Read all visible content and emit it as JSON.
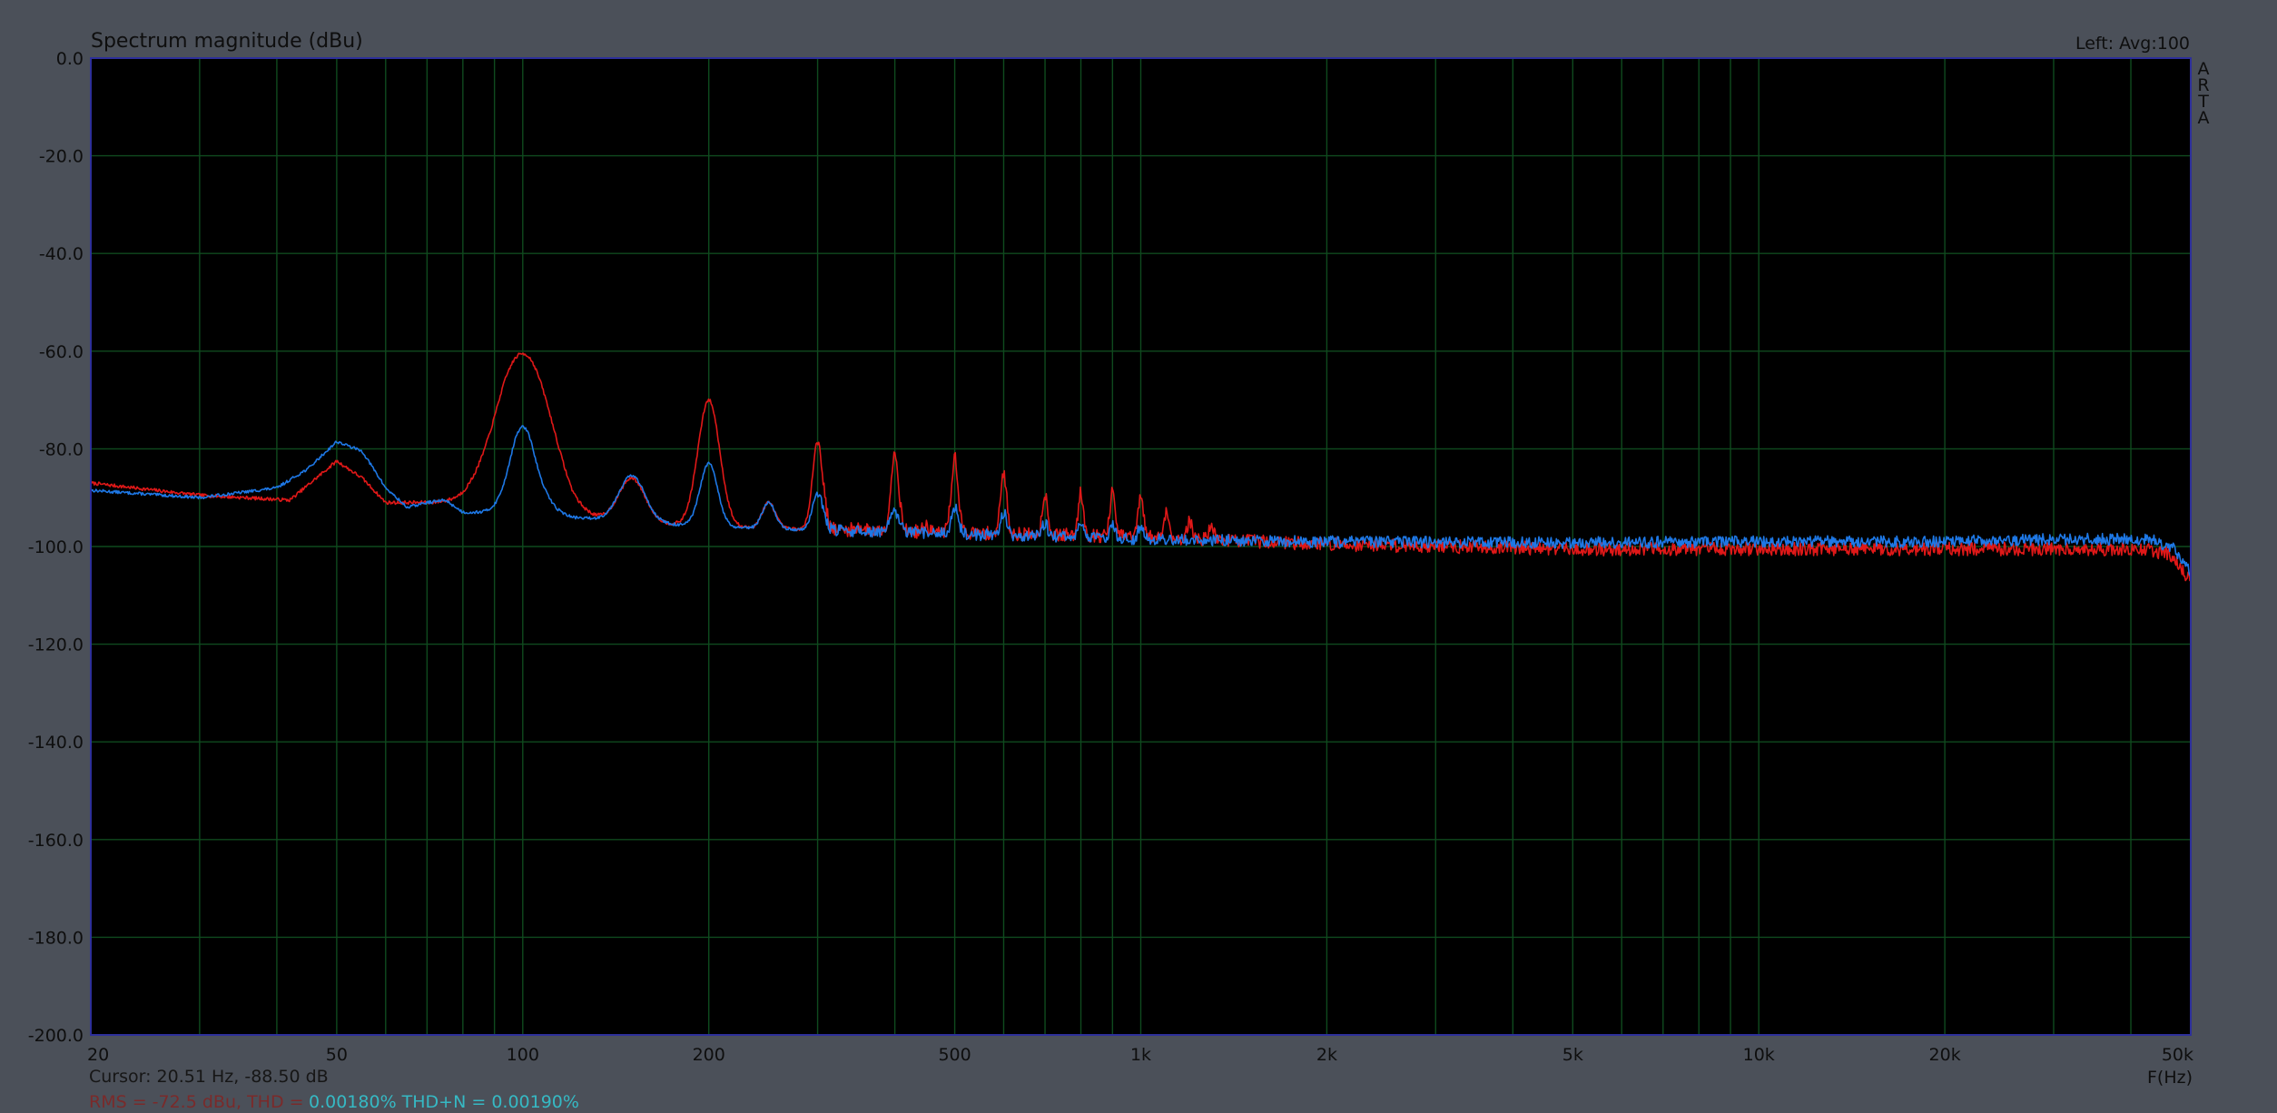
{
  "chart_data": {
    "type": "line",
    "title": "Spectrum magnitude (dBu)",
    "top_right_label": "Left: Avg:100",
    "side_label": "A\nR\nT\nA",
    "xlabel": "F(Hz)",
    "ylabel": "",
    "x_scale": "log",
    "xlim": [
      20,
      50000
    ],
    "ylim": [
      -200,
      0
    ],
    "grid": true,
    "x_major_ticks": [
      20,
      50,
      100,
      200,
      500,
      1000,
      2000,
      5000,
      10000,
      20000,
      50000
    ],
    "x_tick_labels": [
      "20",
      "50",
      "100",
      "200",
      "500",
      "1k",
      "2k",
      "5k",
      "10k",
      "20k",
      "50k"
    ],
    "x_minor_grid": [
      30,
      40,
      60,
      70,
      80,
      90,
      300,
      400,
      600,
      700,
      800,
      900,
      3000,
      4000,
      6000,
      7000,
      8000,
      9000,
      30000,
      40000
    ],
    "y_ticks": [
      0,
      -20,
      -40,
      -60,
      -80,
      -100,
      -120,
      -140,
      -160,
      -180,
      -200
    ],
    "y_tick_labels": [
      "0.0",
      "-20.0",
      "-40.0",
      "-60.0",
      "-80.0",
      "-100.0",
      "-120.0",
      "-140.0",
      "-160.0",
      "-180.0",
      "-200.0"
    ],
    "cursor_text": "Cursor: 20.51 Hz, -88.50 dB",
    "stats_left_text": "RMS = -72.5 dBu, THD =",
    "stats_right_text": "0.00180%  THD+N = 0.00190%",
    "colors": {
      "background": "#4b5059",
      "plot_bg": "#000000",
      "frame": "#2d2f9a",
      "grid": "#0f4a1e",
      "series_red": "#e01818",
      "series_blue": "#1e78e6",
      "stats_left": "#7a2a2a",
      "stats_right": "#36b9c4"
    },
    "series": [
      {
        "color": "#e01818",
        "base": [
          [
            20,
            -87
          ],
          [
            30,
            -89.5
          ],
          [
            42,
            -90.5
          ],
          [
            50,
            -82.5
          ],
          [
            55,
            -86
          ],
          [
            60,
            -91
          ],
          [
            70,
            -91
          ],
          [
            80,
            -91
          ],
          [
            90,
            -90
          ],
          [
            95,
            -86
          ],
          [
            100,
            -84
          ],
          [
            105,
            -88
          ],
          [
            120,
            -94
          ],
          [
            200,
            -96
          ],
          [
            1000,
            -98
          ],
          [
            2000,
            -99.5
          ],
          [
            5000,
            -100.5
          ],
          [
            10000,
            -100.5
          ],
          [
            20000,
            -100.5
          ],
          [
            42000,
            -100.5
          ],
          [
            46000,
            -101.5
          ],
          [
            50000,
            -107
          ]
        ],
        "peaks": [
          [
            100,
            -60.5,
            0.06
          ],
          [
            150,
            -86,
            0.03
          ],
          [
            200,
            -70,
            0.025
          ],
          [
            250,
            -91,
            0.015
          ],
          [
            300,
            -78.5,
            0.012
          ],
          [
            350,
            -96,
            0.01
          ],
          [
            400,
            -81,
            0.009
          ],
          [
            450,
            -96,
            0.008
          ],
          [
            500,
            -82,
            0.008
          ],
          [
            600,
            -85,
            0.007
          ],
          [
            700,
            -89,
            0.006
          ],
          [
            800,
            -89,
            0.006
          ],
          [
            900,
            -89,
            0.006
          ],
          [
            1000,
            -90,
            0.006
          ],
          [
            1100,
            -93,
            0.006
          ],
          [
            1200,
            -95,
            0.006
          ],
          [
            1300,
            -95,
            0.005
          ]
        ],
        "noise_amp": 1.4,
        "seed": 7
      },
      {
        "color": "#1e78e6",
        "base": [
          [
            20,
            -88.5
          ],
          [
            30,
            -90
          ],
          [
            40,
            -88
          ],
          [
            45,
            -84
          ],
          [
            50,
            -78.5
          ],
          [
            55,
            -80.5
          ],
          [
            60,
            -88
          ],
          [
            65,
            -92
          ],
          [
            70,
            -91
          ],
          [
            75,
            -90.5
          ],
          [
            80,
            -93
          ],
          [
            90,
            -93
          ],
          [
            95,
            -93.5
          ],
          [
            100,
            -92
          ],
          [
            105,
            -93
          ],
          [
            110,
            -92
          ],
          [
            120,
            -94
          ],
          [
            200,
            -96
          ],
          [
            1000,
            -98.5
          ],
          [
            2000,
            -99
          ],
          [
            5000,
            -99.2
          ],
          [
            10000,
            -99
          ],
          [
            20000,
            -99
          ],
          [
            30000,
            -98.5
          ],
          [
            43000,
            -98.5
          ],
          [
            47000,
            -100.5
          ],
          [
            50000,
            -105
          ]
        ],
        "peaks": [
          [
            100,
            -75.5,
            0.03
          ],
          [
            150,
            -85.5,
            0.03
          ],
          [
            200,
            -83,
            0.02
          ],
          [
            250,
            -91,
            0.015
          ],
          [
            300,
            -89,
            0.012
          ],
          [
            400,
            -93,
            0.01
          ],
          [
            500,
            -92,
            0.008
          ],
          [
            600,
            -93,
            0.007
          ],
          [
            700,
            -95,
            0.006
          ],
          [
            800,
            -95,
            0.006
          ],
          [
            900,
            -95,
            0.006
          ],
          [
            1000,
            -95.5,
            0.006
          ]
        ],
        "noise_amp": 1.2,
        "seed": 13
      }
    ]
  }
}
